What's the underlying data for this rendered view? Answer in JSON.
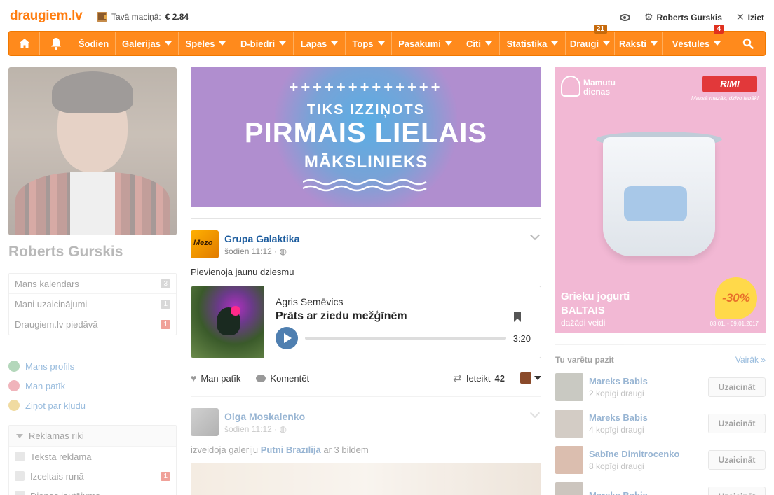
{
  "brand": {
    "logo": "draugiem.lv",
    "accent": "#ff8a1c"
  },
  "wallet": {
    "label": "Tavā maciņā:",
    "amount": "€ 2.84"
  },
  "topRight": {
    "user": "Roberts Gurskis",
    "logout": "Iziet"
  },
  "nav": [
    {
      "id": "home",
      "label": "",
      "icon": "home-icon",
      "caret": false
    },
    {
      "id": "notifications",
      "label": "",
      "icon": "bell-icon",
      "caret": false
    },
    {
      "id": "sodien",
      "label": "Šodien",
      "caret": false
    },
    {
      "id": "galerijas",
      "label": "Galerijas",
      "caret": true
    },
    {
      "id": "speles",
      "label": "Spēles",
      "caret": true
    },
    {
      "id": "dbiedri",
      "label": "D-biedri",
      "caret": true
    },
    {
      "id": "lapas",
      "label": "Lapas",
      "caret": true
    },
    {
      "id": "tops",
      "label": "Tops",
      "caret": true
    },
    {
      "id": "pasakumi",
      "label": "Pasākumi",
      "caret": true
    },
    {
      "id": "citi",
      "label": "Citi",
      "caret": true
    },
    {
      "id": "statistika",
      "label": "Statistika",
      "caret": true
    },
    {
      "id": "draugi",
      "label": "Draugi",
      "caret": true,
      "badge": "21",
      "badgeColor": "brown"
    },
    {
      "id": "raksti",
      "label": "Raksti",
      "caret": true
    },
    {
      "id": "vestules",
      "label": "Vēstules",
      "caret": true,
      "badge": "4",
      "badgeColor": "red"
    },
    {
      "id": "search",
      "label": "",
      "icon": "search-icon",
      "caret": false
    }
  ],
  "profile": {
    "name": "Roberts Gurskis",
    "menu": [
      {
        "label": "Mans kalendārs",
        "count": "3",
        "red": false
      },
      {
        "label": "Mani uzaicinājumi",
        "count": "1",
        "red": false
      },
      {
        "label": "Draugiem.lv piedāvā",
        "count": "1",
        "red": true
      }
    ],
    "links": [
      {
        "label": "Mans profils",
        "icon": "user-icon",
        "color": "#5aa86a"
      },
      {
        "label": "Man patīk",
        "icon": "heart-icon",
        "color": "#e05a6a"
      },
      {
        "label": "Ziņot par kļūdu",
        "icon": "bug-icon",
        "color": "#e0b030"
      }
    ],
    "tools": {
      "title": "Reklāmas rīki",
      "items": [
        {
          "label": "Teksta reklāma",
          "count": ""
        },
        {
          "label": "Izceltais runā",
          "count": "1"
        },
        {
          "label": "Dienas jautājums",
          "count": ""
        }
      ]
    }
  },
  "banner": {
    "plus": "+++++++++++++",
    "line1": "TIKS IZZIŅOTS",
    "line2": "PIRMAIS LIELAIS",
    "line3": "MĀKSLINIEKS"
  },
  "post1": {
    "author": "Grupa Galaktika",
    "time": "šodien 11:12",
    "text": "Pievienoja jaunu dziesmu",
    "music": {
      "artist": "Agris Semēvics",
      "title": "Prāts ar ziedu mežģīnēm",
      "duration": "3:20"
    },
    "actions": {
      "like": "Man patīk",
      "comment": "Komentēt",
      "share": "Ieteikt",
      "shareCount": "42"
    }
  },
  "post2": {
    "author": "Olga Moskalenko",
    "time": "šodien 11:12",
    "textPre": "izveidoja galeriju",
    "gallery": "Putni Brazīlijā",
    "textPost": "ar 3 bildēm"
  },
  "ad": {
    "brand1": "Mamutu",
    "brand2": "dienas",
    "rimi": "RIMI",
    "slogan": "Maksā mazāk, dzīvo labāk!",
    "title1": "Grieķu jogurti",
    "title2": "BALTAIS",
    "sub": "dažādi veidi",
    "discount": "-30%",
    "date": "03.01. - 09.01.2017"
  },
  "suggest": {
    "title": "Tu varētu pazīt",
    "more": "Vairāk »",
    "button": "Uzaicināt",
    "people": [
      {
        "name": "Mareks Babis",
        "sub": "2 kopīgi draugi",
        "color": "#8a8a7a"
      },
      {
        "name": "Mareks Babis",
        "sub": "4 kopīgi draugi",
        "color": "#a09080"
      },
      {
        "name": "Sabīne Dimitrocenko",
        "sub": "8 kopīgi draugi",
        "color": "#b07050"
      },
      {
        "name": "Mareks Babis",
        "sub": "",
        "color": "#908070"
      }
    ]
  }
}
